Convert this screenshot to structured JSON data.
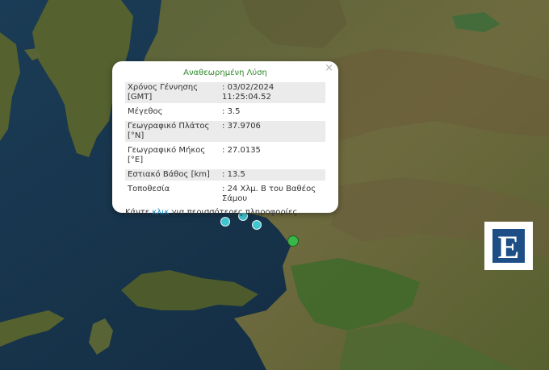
{
  "popup": {
    "close_label": "×",
    "title": "Αναθεωρημένη Λύση",
    "rows": [
      {
        "label": "Χρόνος Γέννησης [GMT]",
        "value": "03/02/2024 11:25:04.52"
      },
      {
        "label": "Μέγεθος",
        "value": "3.5"
      },
      {
        "label": "Γεωγραφικό Πλάτος [°N]",
        "value": "37.9706"
      },
      {
        "label": "Γεωγραφικό Μήκος [°E]",
        "value": "27.0135"
      },
      {
        "label": "Εστιακό Βάθος [km]",
        "value": "13.5"
      },
      {
        "label": "Τοποθεσία",
        "value": "24 Χλμ. Β του Βαθέος Σάμου"
      }
    ],
    "more_prefix": "Κάντε ",
    "more_link": "κλικ",
    "more_suffix": " για περισσότερες πληροφορίες"
  },
  "logo": {
    "letter": "Ε"
  },
  "colors": {
    "sea": "#16324a",
    "land": "#4a5a32",
    "quake_marker": "#3fc6d1",
    "station_marker": "#39b54a",
    "popup_title": "#2f8a2b",
    "link": "#1a8fc4",
    "logo_blue": "#1d4f86"
  }
}
